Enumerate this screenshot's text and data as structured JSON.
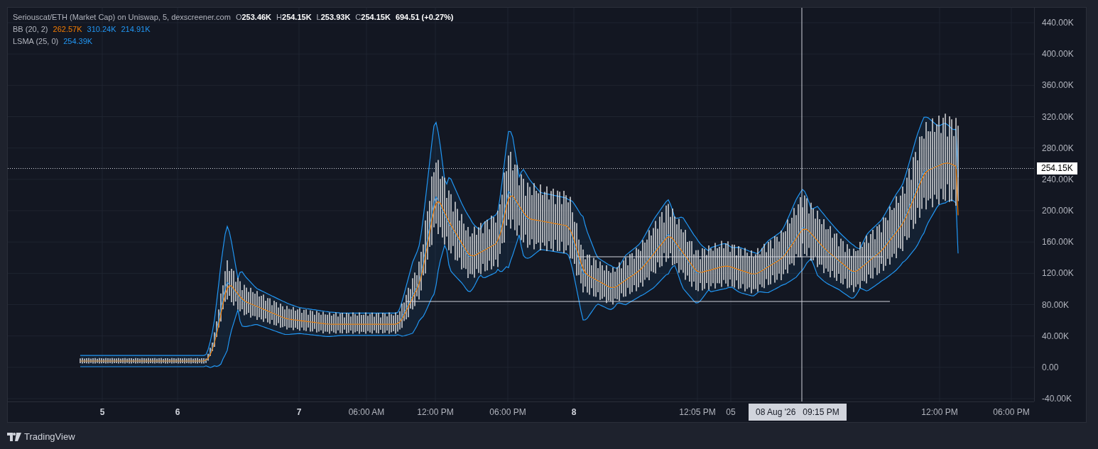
{
  "legend": {
    "title": "Seriouscat/ETH (Market Cap) on Uniswap, 5, dexscreener.com",
    "ohlc": [
      {
        "key": "O",
        "value": "253.46K"
      },
      {
        "key": "H",
        "value": "254.15K"
      },
      {
        "key": "L",
        "value": "253.93K"
      },
      {
        "key": "C",
        "value": "254.15K"
      }
    ],
    "change": "694.51 (+0.27%)"
  },
  "indicators": [
    {
      "name": "BB (20, 2)",
      "values": [
        {
          "text": "262.57K",
          "color": "#f57c00"
        },
        {
          "text": "310.24K",
          "color": "#2196f3"
        },
        {
          "text": "214.91K",
          "color": "#2196f3"
        }
      ]
    },
    {
      "name": "LSMA (25, 0)",
      "values": [
        {
          "text": "254.39K",
          "color": "#2196f3"
        }
      ]
    }
  ],
  "y_axis": {
    "ticks": [
      "440.00K",
      "400.00K",
      "360.00K",
      "320.00K",
      "280.00K",
      "240.00K",
      "200.00K",
      "160.00K",
      "120.00K",
      "80.00K",
      "40.00K",
      "0.00",
      "-40.00K"
    ]
  },
  "last_price": "254.15K",
  "x_axis": {
    "ticks": [
      {
        "label": "5",
        "bold": true
      },
      {
        "label": "6",
        "bold": true
      },
      {
        "label": "7",
        "bold": true
      },
      {
        "label": "06:00 AM",
        "bold": false
      },
      {
        "label": "12:00 PM",
        "bold": false
      },
      {
        "label": "06:00 PM",
        "bold": false
      },
      {
        "label": "8",
        "bold": true
      },
      {
        "label": "12:05 PM",
        "bold": false
      },
      {
        "label": "05",
        "bold": false
      },
      {
        "label": "12:00 PM",
        "bold": false
      },
      {
        "label": "06:00 PM",
        "bold": false
      }
    ]
  },
  "crosshair": {
    "time": "08 Aug '26   09:15 PM"
  },
  "footer": {
    "brand": "TradingView"
  }
}
